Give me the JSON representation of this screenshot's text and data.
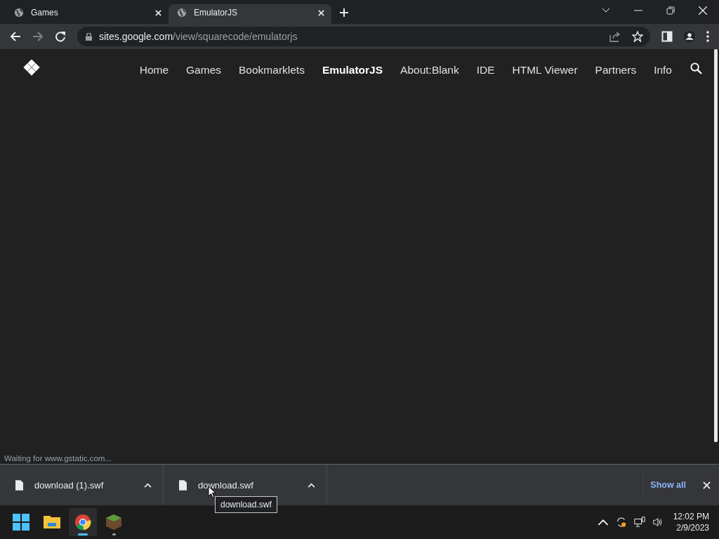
{
  "tabs": [
    {
      "title": "Games",
      "selected": false
    },
    {
      "title": "EmulatorJS",
      "selected": true
    }
  ],
  "address_bar": {
    "host": "sites.google.com",
    "path": "/view/squarecode/emulatorjs"
  },
  "site_nav": [
    {
      "label": "Home",
      "selected": false
    },
    {
      "label": "Games",
      "selected": false
    },
    {
      "label": "Bookmarklets",
      "selected": false
    },
    {
      "label": "EmulatorJS",
      "selected": true
    },
    {
      "label": "About:Blank",
      "selected": false
    },
    {
      "label": "IDE",
      "selected": false
    },
    {
      "label": "HTML Viewer",
      "selected": false
    },
    {
      "label": "Partners",
      "selected": false
    },
    {
      "label": "Info",
      "selected": false
    }
  ],
  "status_bar": "Waiting for www.gstatic.com...",
  "downloads": [
    {
      "filename": "download (1).swf"
    },
    {
      "filename": "download.swf"
    }
  ],
  "download_bar": {
    "show_all": "Show all"
  },
  "tooltip": "download.swf",
  "taskbar": {
    "apps": [
      {
        "kind": "start",
        "running": false
      },
      {
        "kind": "files",
        "running": false
      },
      {
        "kind": "browser",
        "running": true
      },
      {
        "kind": "block",
        "running": true
      }
    ],
    "time": "12:02 PM",
    "date": "2/9/2023"
  }
}
